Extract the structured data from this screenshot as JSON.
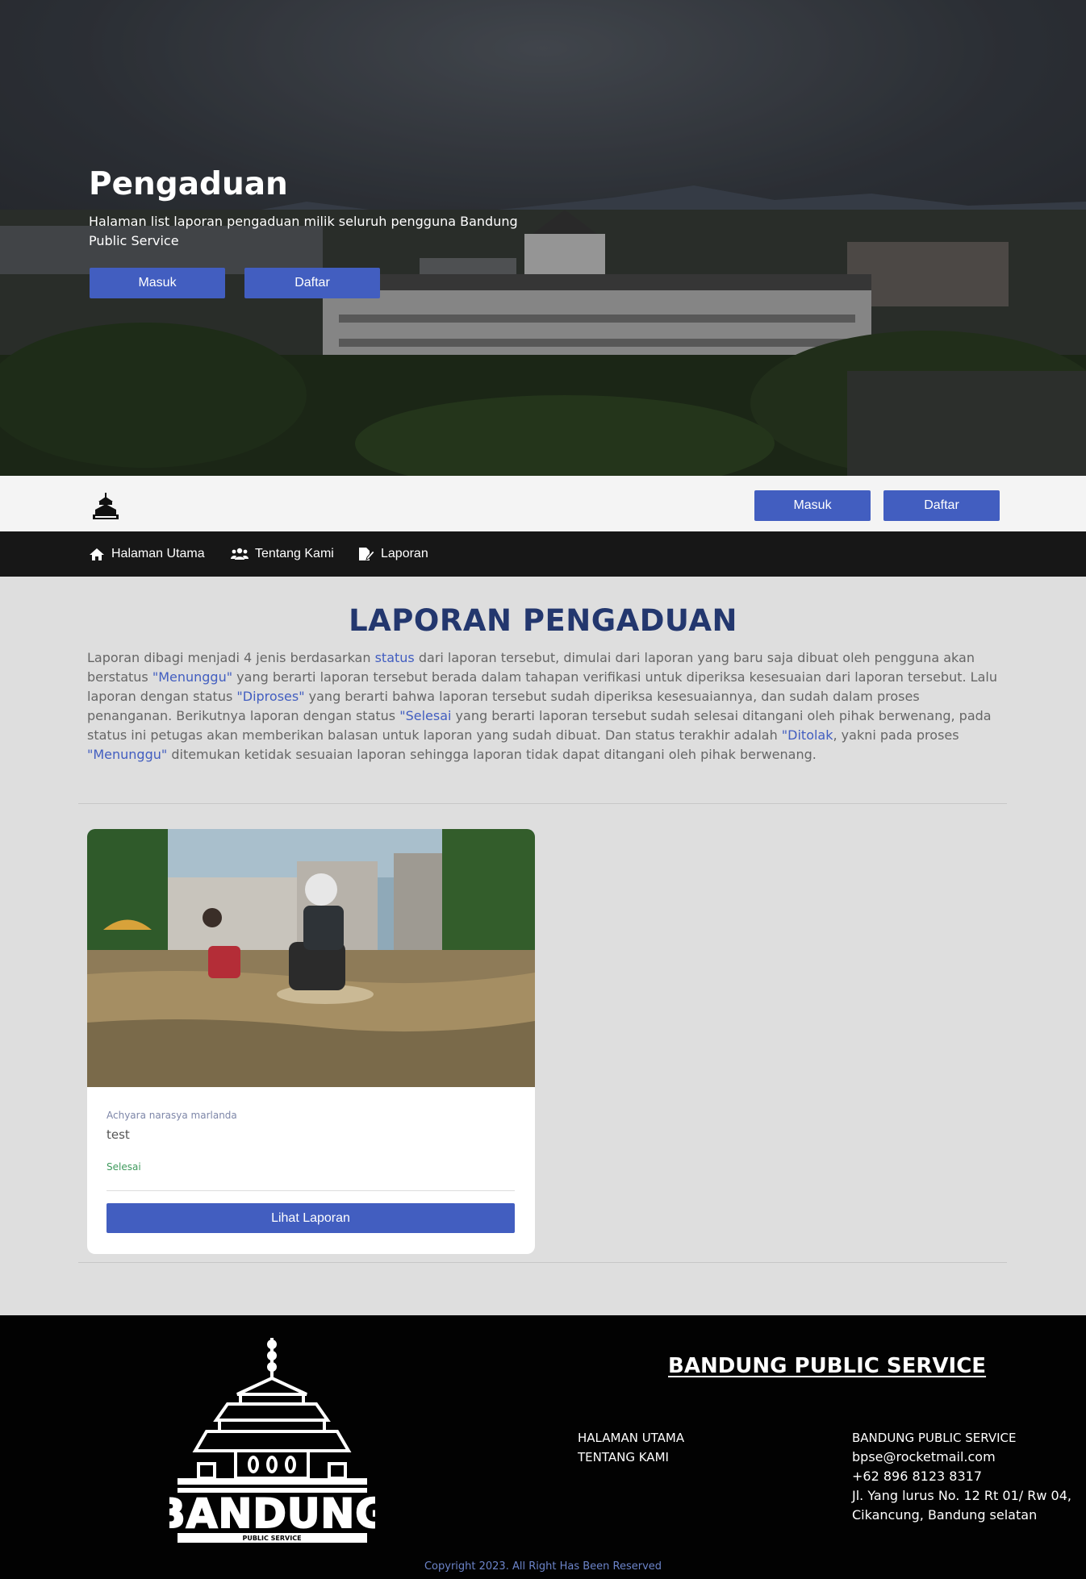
{
  "hero": {
    "title": "Pengaduan",
    "subtitle": "Halaman list laporan pengaduan milik seluruh pengguna Bandung Public Service",
    "login_label": "Masuk",
    "register_label": "Daftar"
  },
  "topbar": {
    "login_label": "Masuk",
    "register_label": "Daftar"
  },
  "nav": {
    "items": [
      {
        "label": "Halaman Utama",
        "icon": "home-icon"
      },
      {
        "label": "Tentang Kami",
        "icon": "users-icon"
      },
      {
        "label": "Laporan",
        "icon": "edit-document-icon"
      }
    ]
  },
  "main": {
    "title": "LAPORAN PENGADUAN",
    "intro": {
      "p1": "Laporan dibagi menjadi 4 jenis berdasarkan ",
      "status": "status",
      "p2": " dari laporan tersebut, dimulai dari laporan yang baru saja dibuat oleh pengguna akan berstatus ",
      "menunggu": "\"Menunggu\"",
      "p3": " yang berarti laporan tersebut berada dalam tahapan verifikasi untuk diperiksa kesesuaian dari laporan tersebut. Lalu laporan dengan status ",
      "diproses": "\"Diproses\"",
      "p4": " yang berarti bahwa laporan tersebut sudah diperiksa kesesuaiannya, dan sudah dalam proses penanganan. Berikutnya laporan dengan status ",
      "selesai": "\"Selesai",
      "p5": " yang berarti laporan tersebut sudah selesai ditangani oleh pihak berwenang, pada status ini petugas akan memberikan balasan untuk laporan yang sudah dibuat. Dan status terakhir adalah ",
      "ditolak": "\"Ditolak",
      "p6": ", yakni pada proses ",
      "menunggu2": "\"Menunggu\"",
      "p7": " ditemukan ketidak sesuaian laporan sehingga laporan tidak dapat ditangani oleh pihak berwenang."
    }
  },
  "report_card": {
    "author": "Achyara narasya marlanda",
    "description": "test",
    "status": "Selesai",
    "button_label": "Lihat Laporan"
  },
  "footer": {
    "logo_text": "BANDUNG",
    "logo_subtext": "PUBLIC SERVICE",
    "heading": "BANDUNG PUBLIC SERVICE",
    "links": [
      "HALAMAN UTAMA",
      "TENTANG KAMI"
    ],
    "contact": {
      "name": "BANDUNG PUBLIC SERVICE",
      "email": "bpse@rocketmail.com",
      "phone": "+62 896 8123 8317",
      "address": "Jl. Yang lurus No. 12 Rt 01/ Rw 04, Cikancung, Bandung selatan"
    },
    "copyright": "Copyright 2023. All Right Has Been Reserved"
  },
  "colors": {
    "primary": "#425ec0",
    "title": "#23376e",
    "nav_bg": "#171717",
    "footer_bg": "#020202",
    "status_done": "#3f9a5d"
  }
}
